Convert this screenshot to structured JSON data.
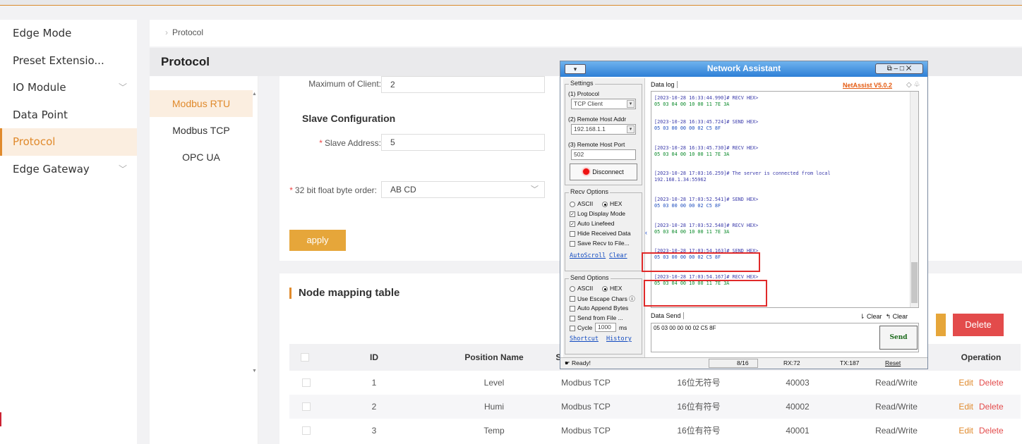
{
  "nav": {
    "items": [
      {
        "label": "Edge Mode",
        "chevron": false
      },
      {
        "label": "Preset Extensio...",
        "chevron": false
      },
      {
        "label": "IO Module",
        "chevron": true
      },
      {
        "label": "Data Point",
        "chevron": false
      },
      {
        "label": "Protocol",
        "chevron": false,
        "active": true
      },
      {
        "label": "Edge Gateway",
        "chevron": true
      }
    ]
  },
  "breadcrumb": {
    "current": "Protocol"
  },
  "page": {
    "title": "Protocol"
  },
  "subnav": [
    "Modbus RTU",
    "Modbus TCP",
    "OPC UA"
  ],
  "form": {
    "max_client_label": "Maximum of Client:",
    "max_client_value": "2",
    "slave_title": "Slave Configuration",
    "slave_address_label": "Slave Address:",
    "slave_address_value": "5",
    "float_order_label": "32 bit float byte order:",
    "float_order_value": "AB CD",
    "apply_label": "apply"
  },
  "mapping": {
    "title": "Node mapping table",
    "delete_label": "Delete",
    "headers": [
      "ID",
      "Position Name",
      "So",
      "Operation"
    ],
    "rows": [
      {
        "id": "1",
        "name": "Level",
        "protocol": "Modbus TCP",
        "type": "16位无符号",
        "address": "40003",
        "rw": "Read/Write"
      },
      {
        "id": "2",
        "name": "Humi",
        "protocol": "Modbus TCP",
        "type": "16位有符号",
        "address": "40002",
        "rw": "Read/Write"
      },
      {
        "id": "3",
        "name": "Temp",
        "protocol": "Modbus TCP",
        "type": "16位有符号",
        "address": "40001",
        "rw": "Read/Write"
      }
    ],
    "edit_label": "Edit",
    "row_delete_label": "Delete"
  },
  "netassist": {
    "title": "Network Assistant",
    "version_link": "NetAssist V5.0.2",
    "settings": {
      "group_title": "Settings",
      "protocol_label": "(1) Protocol",
      "protocol_value": "TCP Client",
      "host_label": "(2) Remote Host Addr",
      "host_value": "192.168.1.1",
      "port_label": "(3) Remote Host Port",
      "port_value": "502",
      "disconnect_label": "Disconnect"
    },
    "recv_options": {
      "group_title": "Recv Options",
      "ascii": "ASCII",
      "hex": "HEX",
      "log_display": "Log Display Mode",
      "auto_linefeed": "Auto Linefeed",
      "hide_received": "Hide Received Data",
      "save_recv": "Save Recv to File...",
      "autoscroll": "AutoScroll",
      "clear": "Clear"
    },
    "send_options": {
      "group_title": "Send Options",
      "ascii": "ASCII",
      "hex": "HEX",
      "escape": "Use Escape Chars",
      "auto_append": "Auto Append Bytes",
      "send_file": "Send from File ...",
      "cycle": "Cycle",
      "cycle_value": "1000",
      "cycle_unit": "ms",
      "shortcut": "Shortcut",
      "history": "History"
    },
    "datalog_tab": "Data log",
    "log": [
      {
        "head": "[2023-10-28 16:33:44.990]# RECV HEX>",
        "data": "05 03 04 00 10 00 11 7E 3A",
        "kind": "recv"
      },
      {
        "head": "[2023-10-28 16:33:45.724]# SEND HEX>",
        "data": "05 03 00 00 00 02 C5 8F",
        "kind": "send"
      },
      {
        "head": "[2023-10-28 16:33:45.730]# RECV HEX>",
        "data": "05 03 04 00 10 00 11 7E 3A",
        "kind": "recv"
      },
      {
        "head": "[2023-10-28 17:03:16.259]# The server is connected from local",
        "data": "192.168.1.34:55962",
        "kind": "info"
      },
      {
        "head": "[2023-10-28 17:03:52.541]# SEND HEX>",
        "data": "05 03 00 00 00 02 C5 8F",
        "kind": "send"
      },
      {
        "head": "[2023-10-28 17:03:52.548]# RECV HEX>",
        "data": "05 03 04 00 10 00 11 7E 3A",
        "kind": "recv"
      },
      {
        "head": "[2023-10-28 17:03:54.163]# SEND HEX>",
        "data": "05 03 00 00 00 02 C5 8F",
        "kind": "send"
      },
      {
        "head": "[2023-10-28 17:03:54.167]# RECV HEX>",
        "data": "05 03 04 00 10 00 11 7E 3A",
        "kind": "recv"
      }
    ],
    "datasend_tab": "Data Send",
    "clear_a": "Clear",
    "clear_b": "Clear",
    "send_text": "05 03 00 00 00 02 C5 8F",
    "send_button": "Send",
    "status": {
      "ready": "Ready!",
      "count": "8/16",
      "rx": "RX:72",
      "tx": "TX:187",
      "reset": "Reset"
    }
  },
  "colors": {
    "accent": "#e08a2c",
    "danger": "#e34b4b",
    "apply": "#e6a63a"
  }
}
